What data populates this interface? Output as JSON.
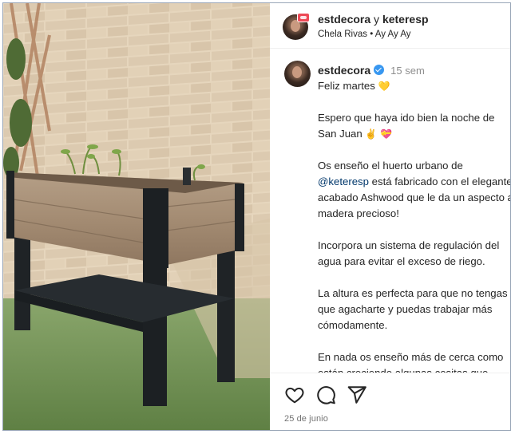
{
  "header": {
    "account_primary": "estdecora",
    "joiner": " y ",
    "account_secondary": "keteresp",
    "audio_line": "Chela Rivas • Ay Ay Ay"
  },
  "caption": {
    "username": "estdecora",
    "time_ago": "15 sem",
    "paragraphs": {
      "p1": "Feliz martes",
      "p2": "Espero que haya ido bien la noche de San Juan",
      "p3_before": "Os enseño el huerto urbano de",
      "p3_mention": "@keteresp",
      "p3_after": "está fabricado con el elegante acabado Ashwood que le da un aspecto a madera precioso!",
      "p4": "Incorpora un sistema de regulación del agua para evitar el exceso de riego.",
      "p5": "La altura es perfecta para que no tengas que agacharte y puedas trabajar más cómodamente.",
      "p6": "En nada os enseño más de cerca como están creciendo algunas cositas que plantamos, aunque al final del video podéis ver a Alma regándole y la altura"
    },
    "emojis": {
      "heart_yellow": "💛",
      "victory_hand": "✌",
      "heart_ribbon": "💝"
    }
  },
  "actions": {
    "date": "25 de junio"
  },
  "icons": {
    "like": "heart-icon",
    "comment": "comment-icon",
    "share": "share-icon",
    "verified": "verified-badge-icon"
  },
  "colors": {
    "verified": "#3897f0",
    "mention": "#00376b",
    "muted": "#8e8e8e",
    "badge": "#ed4956"
  }
}
